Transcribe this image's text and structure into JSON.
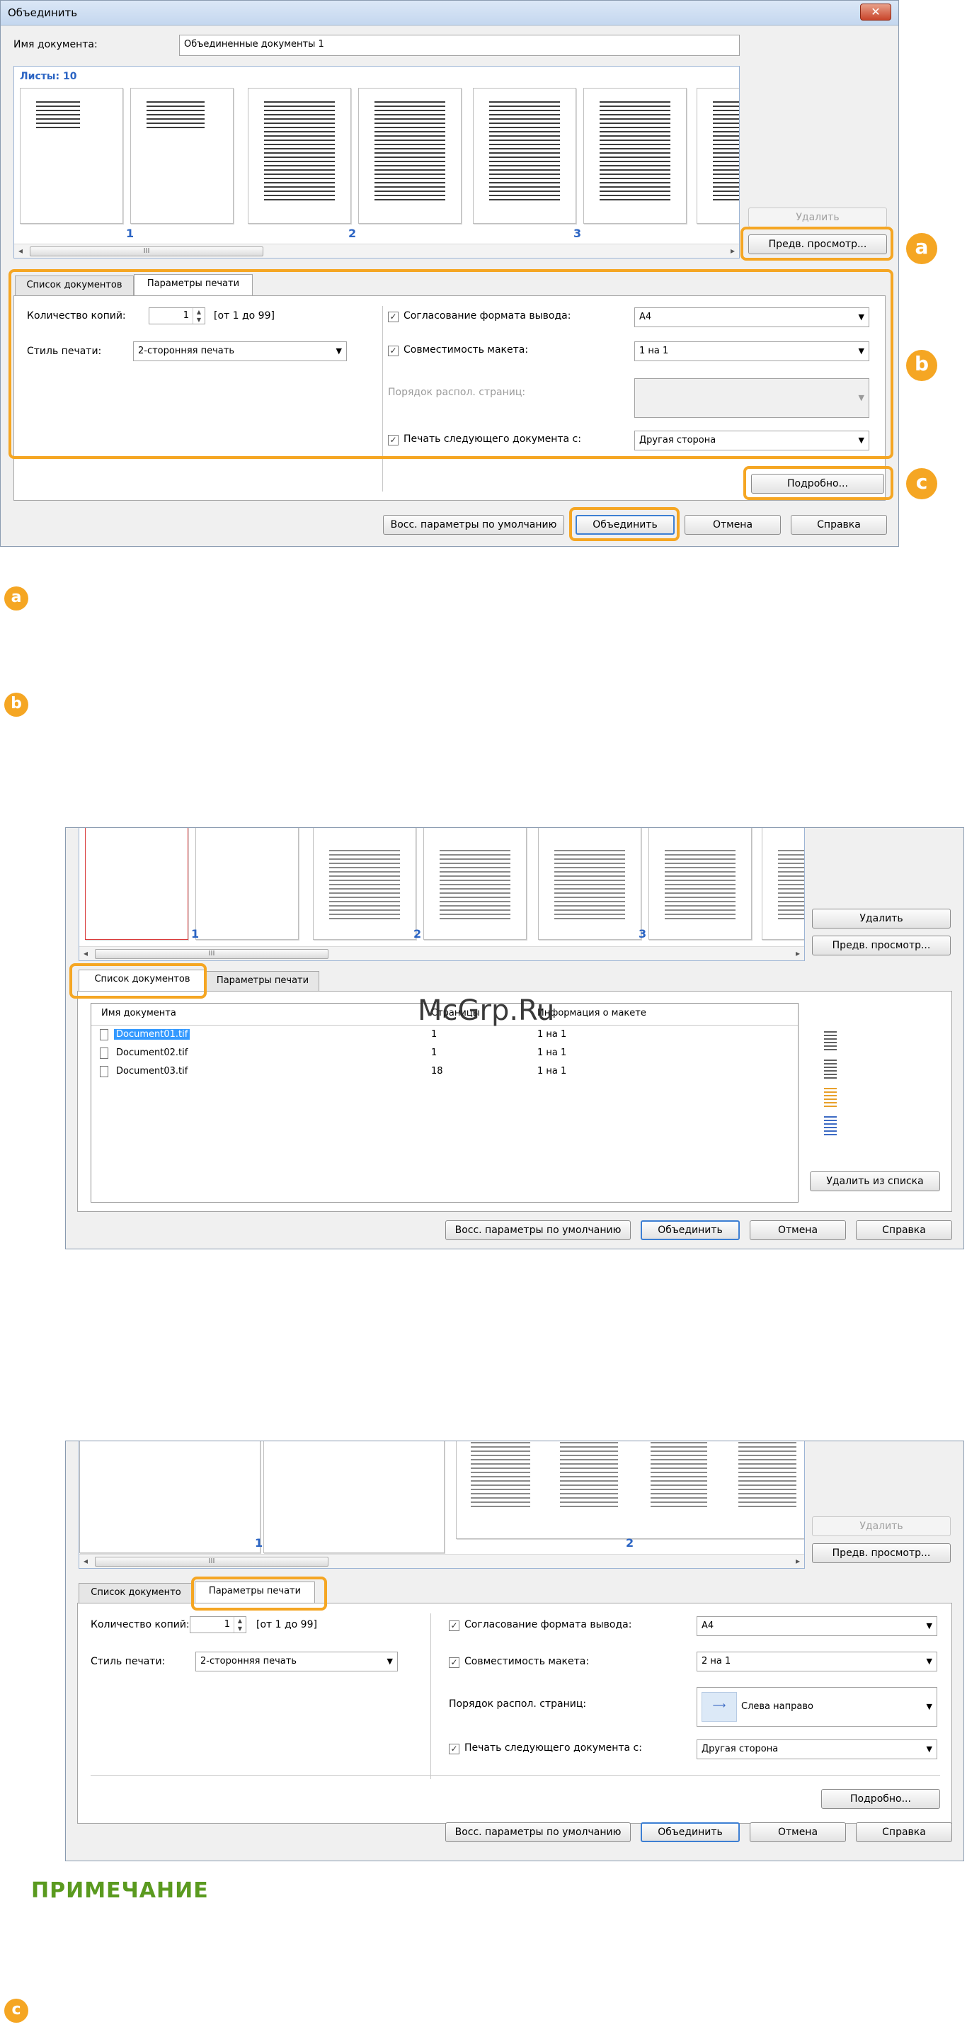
{
  "dialog1": {
    "title": "Объединить",
    "close_label": "✕",
    "doc_name_label": "Имя документа:",
    "doc_name_value": "Объединенные документы 1",
    "sheets_label": "Листы: 10",
    "page_numbers": [
      "1",
      "2",
      "3"
    ],
    "scroll_thumb": "III",
    "delete_button": "Удалить",
    "preview_button": "Предв. просмотр...",
    "tabs": [
      "Список документов",
      "Параметры печати"
    ],
    "copies_label": "Количество копий:",
    "copies_value": "1",
    "copies_range": "[от 1 до 99]",
    "print_style_label": "Стиль печати:",
    "print_style_value": "2-сторонняя печать",
    "match_format_label": "Согласование формата вывода:",
    "match_format_value": "А4",
    "layout_compat_label": "Совместимость макета:",
    "layout_compat_value": "1 на 1",
    "page_order_label": "Порядок распол. страниц:",
    "next_doc_label": "Печать следующего документа с:",
    "next_doc_value": "Другая сторона",
    "details_button": "Подробно...",
    "restore_button": "Восс. параметры по умолчанию",
    "merge_button": "Объединить",
    "cancel_button": "Отмена",
    "help_button": "Справка"
  },
  "badges": {
    "a": "a",
    "b": "b",
    "c": "c"
  },
  "dialog2": {
    "page_numbers": [
      "1",
      "2",
      "3"
    ],
    "scroll_thumb": "III",
    "delete_button": "Удалить",
    "preview_button": "Предв. просмотр...",
    "tabs": [
      "Список документов",
      "Параметры печати"
    ],
    "columns": [
      "Имя документа",
      "Страницы",
      "Информация о макете"
    ],
    "rows": [
      {
        "name": "Document01.tif",
        "pages": "1",
        "layout": "1 на 1"
      },
      {
        "name": "Document02.tif",
        "pages": "1",
        "layout": "1 на 1"
      },
      {
        "name": "Document03.tif",
        "pages": "18",
        "layout": "1 на 1"
      }
    ],
    "remove_button": "Удалить из списка",
    "restore_button": "Восс. параметры по умолчанию",
    "merge_button": "Объединить",
    "cancel_button": "Отмена",
    "help_button": "Справка"
  },
  "watermark": "McGrp.Ru",
  "dialog3": {
    "page_numbers": [
      "1",
      "2"
    ],
    "scroll_thumb": "III",
    "delete_button": "Удалить",
    "preview_button": "Предв. просмотр...",
    "tabs": [
      "Список документо",
      "Параметры печати"
    ],
    "copies_label": "Количество копий:",
    "copies_value": "1",
    "copies_range": "[от 1 до 99]",
    "print_style_label": "Стиль печати:",
    "print_style_value": "2-сторонняя печать",
    "match_format_label": "Согласование формата вывода:",
    "match_format_value": "А4",
    "layout_compat_label": "Совместимость макета:",
    "layout_compat_value": "2 на 1",
    "page_order_label": "Порядок распол. страниц:",
    "page_order_value": "Слева направо",
    "next_doc_label": "Печать следующего документа с:",
    "next_doc_value": "Другая сторона",
    "details_button": "Подробно...",
    "restore_button": "Восс. параметры по умолчанию",
    "merge_button": "Объединить",
    "cancel_button": "Отмена",
    "help_button": "Справка"
  },
  "note_heading": "ПРИМЕЧАНИЕ",
  "colors": {
    "accent": "#f5a623",
    "note_green": "#5a9a1f",
    "link_blue": "#2b64c3"
  }
}
